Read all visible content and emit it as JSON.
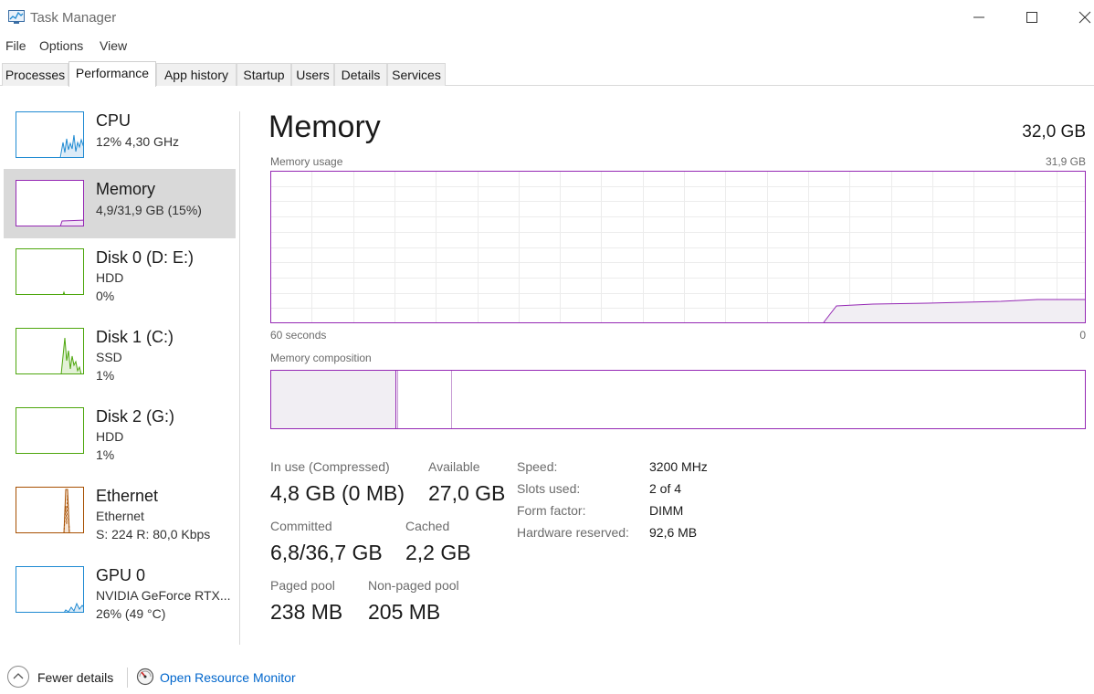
{
  "window": {
    "title": "Task Manager"
  },
  "menu": [
    "File",
    "Options",
    "View"
  ],
  "tabs": [
    "Processes",
    "Performance",
    "App history",
    "Startup",
    "Users",
    "Details",
    "Services"
  ],
  "active_tab": "Performance",
  "sidebar": {
    "items": [
      {
        "name": "CPU",
        "sub1": "12%  4,30 GHz",
        "sub2": "",
        "color": "#1f8ad2"
      },
      {
        "name": "Memory",
        "sub1": "4,9/31,9 GB (15%)",
        "sub2": "",
        "color": "#9528b4"
      },
      {
        "name": "Disk 0 (D: E:)",
        "sub1": "HDD",
        "sub2": "0%",
        "color": "#4da60c"
      },
      {
        "name": "Disk 1 (C:)",
        "sub1": "SSD",
        "sub2": "1%",
        "color": "#4da60c"
      },
      {
        "name": "Disk 2 (G:)",
        "sub1": "HDD",
        "sub2": "1%",
        "color": "#4da60c"
      },
      {
        "name": "Ethernet",
        "sub1": "Ethernet",
        "sub2": "S: 224  R: 80,0 Kbps",
        "color": "#a74f01"
      },
      {
        "name": "GPU 0",
        "sub1": "NVIDIA GeForce RTX...",
        "sub2": "26%  (49 °C)",
        "color": "#1f8ad2"
      }
    ],
    "selected": "Memory"
  },
  "main": {
    "title": "Memory",
    "total": "32,0 GB",
    "usage_label": "Memory usage",
    "usage_max": "31,9 GB",
    "time_left": "60 seconds",
    "time_right": "0",
    "composition_label": "Memory composition",
    "accent": "#9528b4",
    "stats": {
      "in_use_label": "In use (Compressed)",
      "in_use_value": "4,8 GB (0 MB)",
      "available_label": "Available",
      "available_value": "27,0 GB",
      "committed_label": "Committed",
      "committed_value": "6,8/36,7 GB",
      "cached_label": "Cached",
      "cached_value": "2,2 GB",
      "paged_label": "Paged pool",
      "paged_value": "238 MB",
      "nonpaged_label": "Non-paged pool",
      "nonpaged_value": "205 MB"
    },
    "specs": [
      {
        "label": "Speed:",
        "value": "3200 MHz"
      },
      {
        "label": "Slots used:",
        "value": "2 of 4"
      },
      {
        "label": "Form factor:",
        "value": "DIMM"
      },
      {
        "label": "Hardware reserved:",
        "value": "92,6 MB"
      }
    ]
  },
  "footer": {
    "fewer_details": "Fewer details",
    "resource_monitor": "Open Resource Monitor"
  }
}
